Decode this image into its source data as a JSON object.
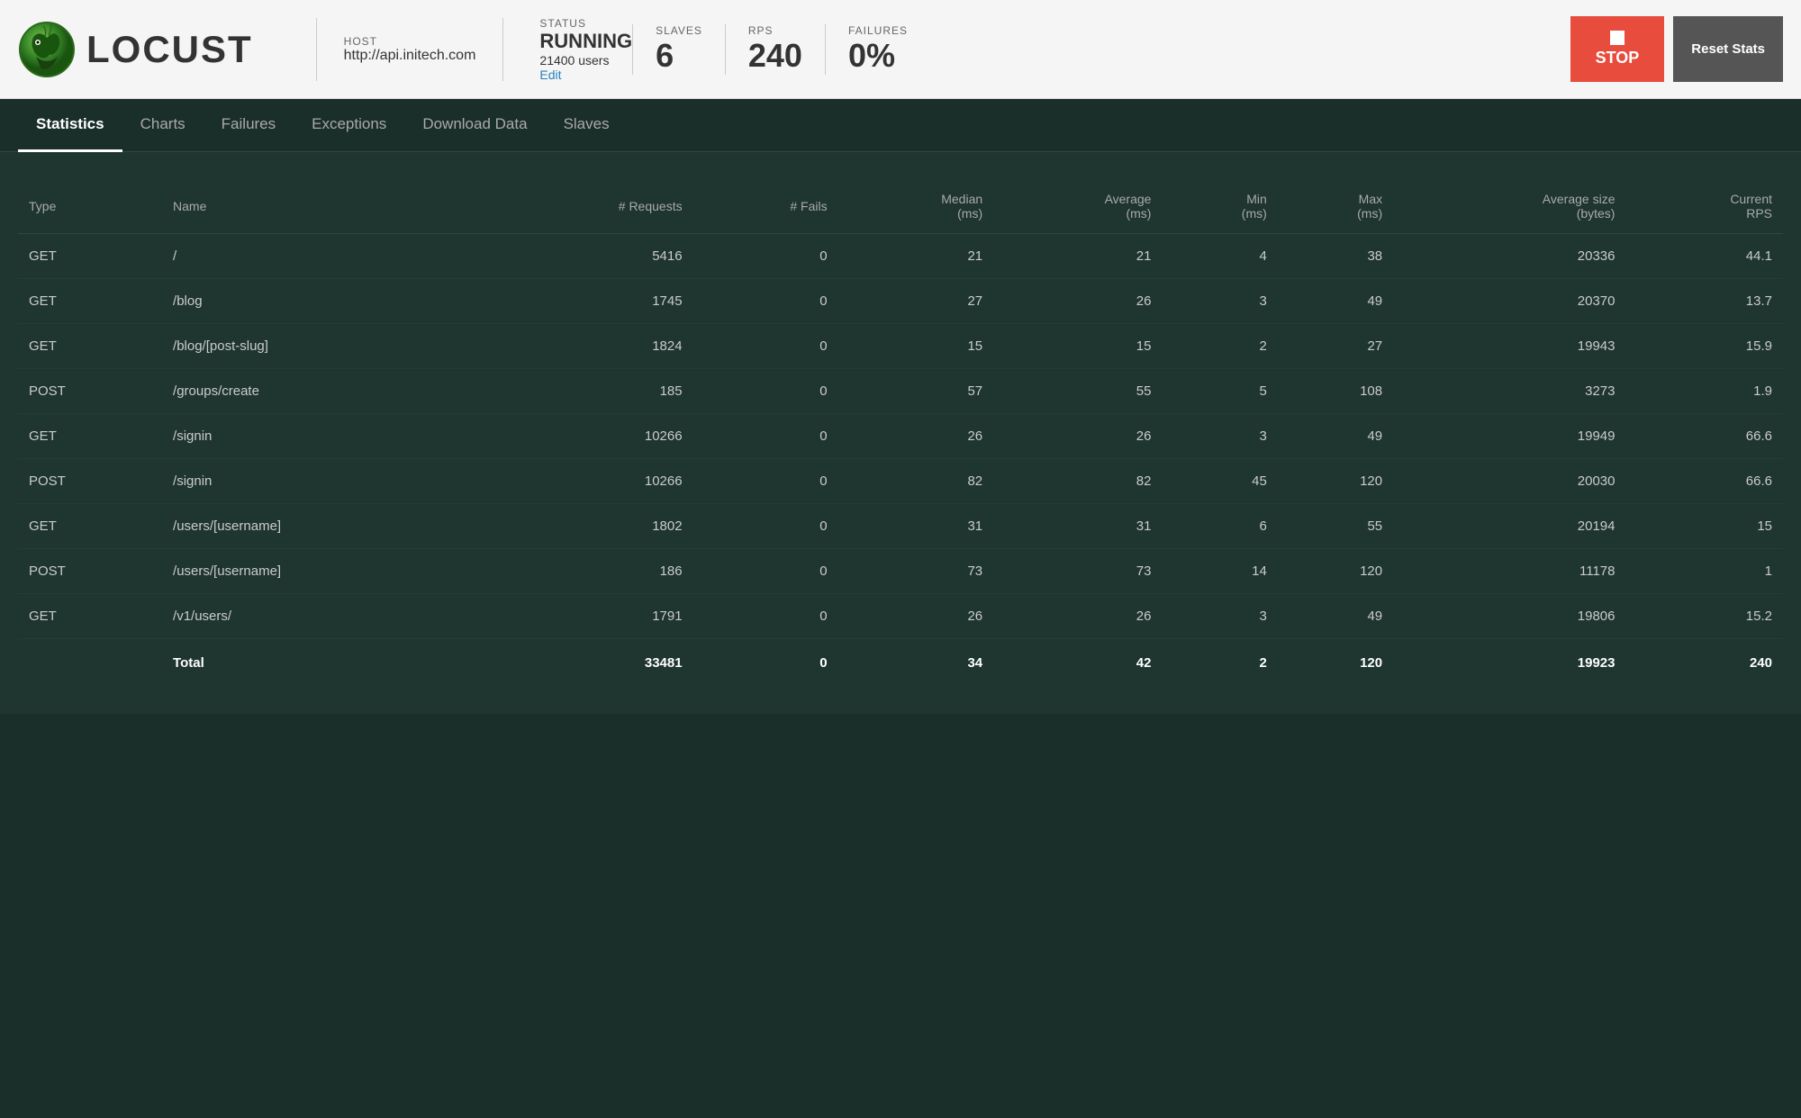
{
  "header": {
    "host_label": "HOST",
    "host_value": "http://api.initech.com",
    "status_label": "STATUS",
    "status_value": "RUNNING",
    "users_value": "21400 users",
    "edit_label": "Edit",
    "slaves_label": "SLAVES",
    "slaves_value": "6",
    "rps_label": "RPS",
    "rps_value": "240",
    "failures_label": "FAILURES",
    "failures_value": "0%",
    "stop_label": "STOP",
    "reset_label": "Reset Stats"
  },
  "nav": {
    "tabs": [
      {
        "label": "Statistics",
        "active": true
      },
      {
        "label": "Charts",
        "active": false
      },
      {
        "label": "Failures",
        "active": false
      },
      {
        "label": "Exceptions",
        "active": false
      },
      {
        "label": "Download Data",
        "active": false
      },
      {
        "label": "Slaves",
        "active": false
      }
    ]
  },
  "table": {
    "columns": [
      {
        "label": "Type",
        "align": "left"
      },
      {
        "label": "Name",
        "align": "left"
      },
      {
        "label": "# Requests",
        "align": "right"
      },
      {
        "label": "# Fails",
        "align": "right"
      },
      {
        "label": "Median\n(ms)",
        "align": "right"
      },
      {
        "label": "Average\n(ms)",
        "align": "right"
      },
      {
        "label": "Min\n(ms)",
        "align": "right"
      },
      {
        "label": "Max\n(ms)",
        "align": "right"
      },
      {
        "label": "Average size\n(bytes)",
        "align": "right"
      },
      {
        "label": "Current\nRPS",
        "align": "right"
      }
    ],
    "rows": [
      {
        "type": "GET",
        "name": "/",
        "requests": "5416",
        "fails": "0",
        "median": "21",
        "average": "21",
        "min": "4",
        "max": "38",
        "avg_size": "20336",
        "rps": "44.1"
      },
      {
        "type": "GET",
        "name": "/blog",
        "requests": "1745",
        "fails": "0",
        "median": "27",
        "average": "26",
        "min": "3",
        "max": "49",
        "avg_size": "20370",
        "rps": "13.7"
      },
      {
        "type": "GET",
        "name": "/blog/[post-slug]",
        "requests": "1824",
        "fails": "0",
        "median": "15",
        "average": "15",
        "min": "2",
        "max": "27",
        "avg_size": "19943",
        "rps": "15.9"
      },
      {
        "type": "POST",
        "name": "/groups/create",
        "requests": "185",
        "fails": "0",
        "median": "57",
        "average": "55",
        "min": "5",
        "max": "108",
        "avg_size": "3273",
        "rps": "1.9"
      },
      {
        "type": "GET",
        "name": "/signin",
        "requests": "10266",
        "fails": "0",
        "median": "26",
        "average": "26",
        "min": "3",
        "max": "49",
        "avg_size": "19949",
        "rps": "66.6"
      },
      {
        "type": "POST",
        "name": "/signin",
        "requests": "10266",
        "fails": "0",
        "median": "82",
        "average": "82",
        "min": "45",
        "max": "120",
        "avg_size": "20030",
        "rps": "66.6"
      },
      {
        "type": "GET",
        "name": "/users/[username]",
        "requests": "1802",
        "fails": "0",
        "median": "31",
        "average": "31",
        "min": "6",
        "max": "55",
        "avg_size": "20194",
        "rps": "15"
      },
      {
        "type": "POST",
        "name": "/users/[username]",
        "requests": "186",
        "fails": "0",
        "median": "73",
        "average": "73",
        "min": "14",
        "max": "120",
        "avg_size": "11178",
        "rps": "1"
      },
      {
        "type": "GET",
        "name": "/v1/users/",
        "requests": "1791",
        "fails": "0",
        "median": "26",
        "average": "26",
        "min": "3",
        "max": "49",
        "avg_size": "19806",
        "rps": "15.2"
      }
    ],
    "footer": {
      "type": "",
      "name": "Total",
      "requests": "33481",
      "fails": "0",
      "median": "34",
      "average": "42",
      "min": "2",
      "max": "120",
      "avg_size": "19923",
      "rps": "240"
    }
  },
  "logo": {
    "text": "LOCUST"
  }
}
